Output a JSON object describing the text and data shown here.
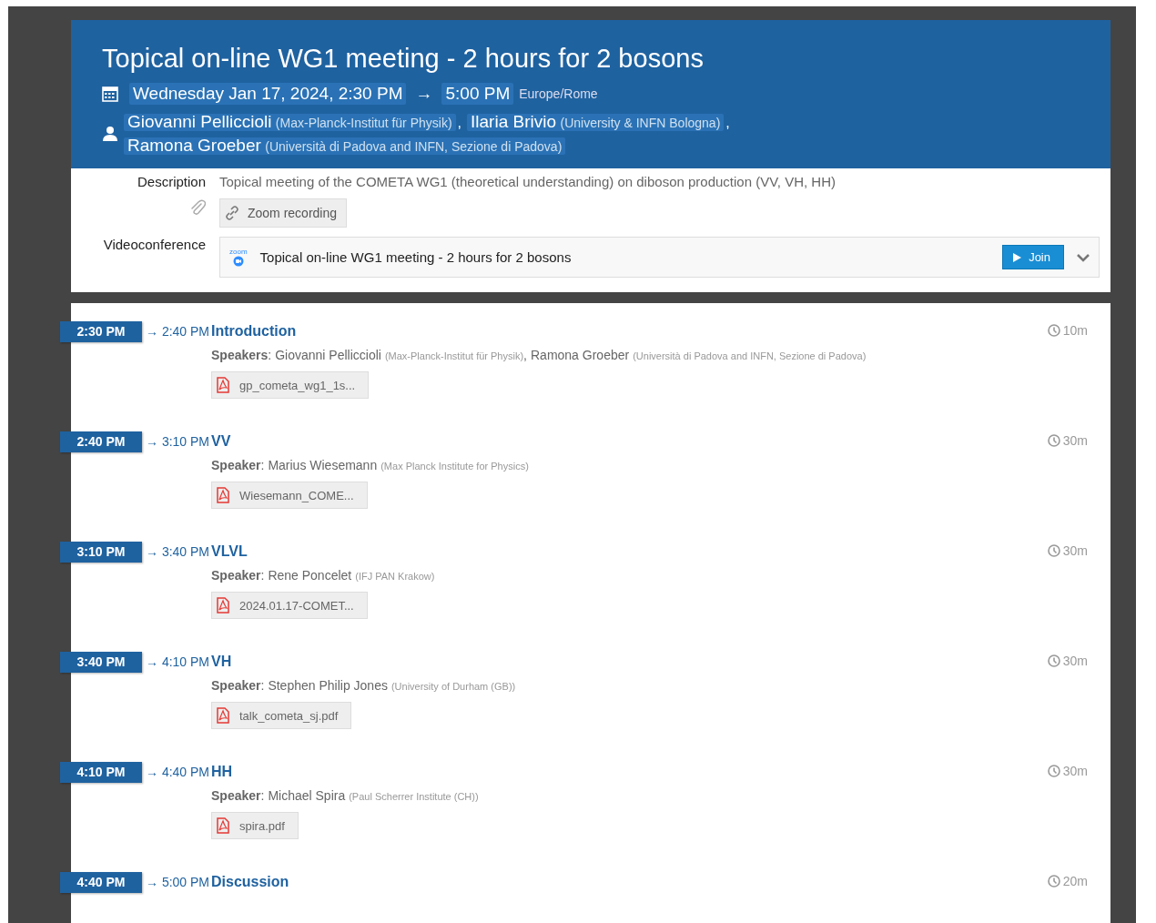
{
  "event": {
    "title": "Topical on-line WG1 meeting - 2 hours for 2 bosons",
    "start": "Wednesday Jan 17, 2024, 2:30 PM",
    "arrow": "→",
    "end": "5:00 PM",
    "timezone": "Europe/Rome",
    "chairs": [
      {
        "name": "Giovanni Pelliccioli",
        "affiliation": "(Max-Planck-Institut für Physik)",
        "separator": ","
      },
      {
        "name": "Ilaria Brivio",
        "affiliation": "(University & INFN Bologna)",
        "separator": ","
      },
      {
        "name": "Ramona Groeber",
        "affiliation": "(Università di Padova and INFN, Sezione di Padova)"
      }
    ]
  },
  "details": {
    "description_label": "Description",
    "description": "Topical meeting of the COMETA WG1 (theoretical understanding) on diboson production (VV, VH, HH)",
    "link": "Zoom recording",
    "videoconference_label": "Videoconference",
    "zoom_logo": "zoom",
    "room": "Topical on-line WG1 meeting - 2 hours for 2 bosons",
    "join": "Join"
  },
  "timetable": [
    {
      "start": "2:30 PM",
      "end": "→ 2:40 PM",
      "title": "Introduction",
      "duration": "10m",
      "speaker_label": "**Speakers**:",
      "speakers": [
        {
          "name": "Giovanni Pelliccioli",
          "affiliation": "(Max-Planck-Institut für Physik)",
          "separator": ","
        },
        {
          "name": "Ramona Groeber",
          "affiliation": "(Università di Padova and INFN, Sezione di Padova)"
        }
      ],
      "attachment": "gp_cometa_wg1_1s..."
    },
    {
      "start": "2:40 PM",
      "end": "→ 3:10 PM",
      "title": "VV",
      "duration": "30m",
      "speaker_label": "**Speaker**:",
      "speakers": [
        {
          "name": "Marius Wiesemann",
          "affiliation": "(Max Planck Institute for Physics)"
        }
      ],
      "attachment": "Wiesemann_COME..."
    },
    {
      "start": "3:10 PM",
      "end": "→ 3:40 PM",
      "title": "VLVL",
      "duration": "30m",
      "speaker_label": "**Speaker**:",
      "speakers": [
        {
          "name": "Rene Poncelet",
          "affiliation": "(IFJ PAN Krakow)"
        }
      ],
      "attachment": "2024.01.17-COMET..."
    },
    {
      "start": "3:40 PM",
      "end": "→ 4:10 PM",
      "title": "VH",
      "duration": "30m",
      "speaker_label": "**Speaker**:",
      "speakers": [
        {
          "name": "Stephen Philip Jones",
          "affiliation": "(University of Durham (GB))"
        }
      ],
      "attachment": "talk_cometa_sj.pdf"
    },
    {
      "start": "4:10 PM",
      "end": "→ 4:40 PM",
      "title": "HH",
      "duration": "30m",
      "speaker_label": "**Speaker**:",
      "speakers": [
        {
          "name": "Michael Spira",
          "affiliation": "(Paul Scherrer Institute (CH))"
        }
      ],
      "attachment": "spira.pdf"
    },
    {
      "start": "4:40 PM",
      "end": "→ 5:00 PM",
      "title": "Discussion",
      "duration": "20m"
    }
  ]
}
